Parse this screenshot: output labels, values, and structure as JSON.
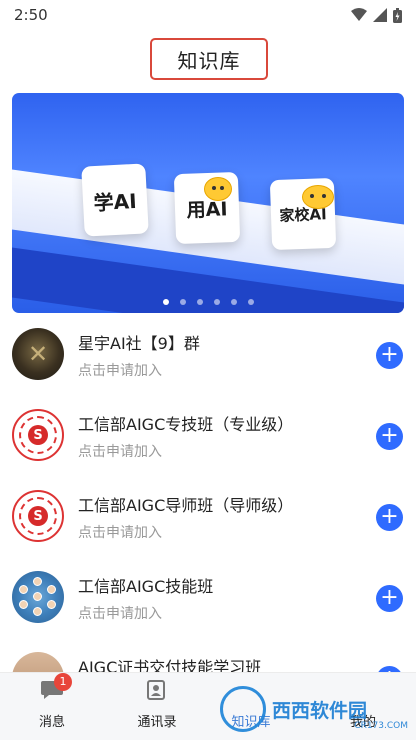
{
  "status": {
    "time": "2:50"
  },
  "header": {
    "title": "知识库"
  },
  "banner": {
    "cards": [
      "学AI",
      "用AI",
      "家校AI"
    ],
    "page_count": 6,
    "active_index": 0
  },
  "groups": [
    {
      "title": "星宇AI社【9】群",
      "subtitle": "点击申请加入",
      "avatar": "group-logo-dark"
    },
    {
      "title": "工信部AIGC专技班（专业级）",
      "subtitle": "点击申请加入",
      "avatar": "miit-logo"
    },
    {
      "title": "工信部AIGC导师班（导师级）",
      "subtitle": "点击申请加入",
      "avatar": "miit-logo"
    },
    {
      "title": "工信部AIGC技能班",
      "subtitle": "点击申请加入",
      "avatar": "people-collage"
    },
    {
      "title": "AIGC证书交付技能学习班",
      "subtitle": "",
      "avatar": "photo"
    }
  ],
  "tabs": [
    {
      "label": "消息",
      "icon": "chat-bubble-icon",
      "badge": "1"
    },
    {
      "label": "通讯录",
      "icon": "contacts-icon"
    },
    {
      "label": "知识库",
      "icon": "knowledge-icon"
    },
    {
      "label": "我的",
      "icon": "profile-icon"
    }
  ],
  "watermark": {
    "brand": "西西软件园",
    "url": "CR173.COM"
  },
  "colors": {
    "accent": "#2f6bff",
    "highlight_border": "#d9483b",
    "badge": "#e8453a"
  }
}
